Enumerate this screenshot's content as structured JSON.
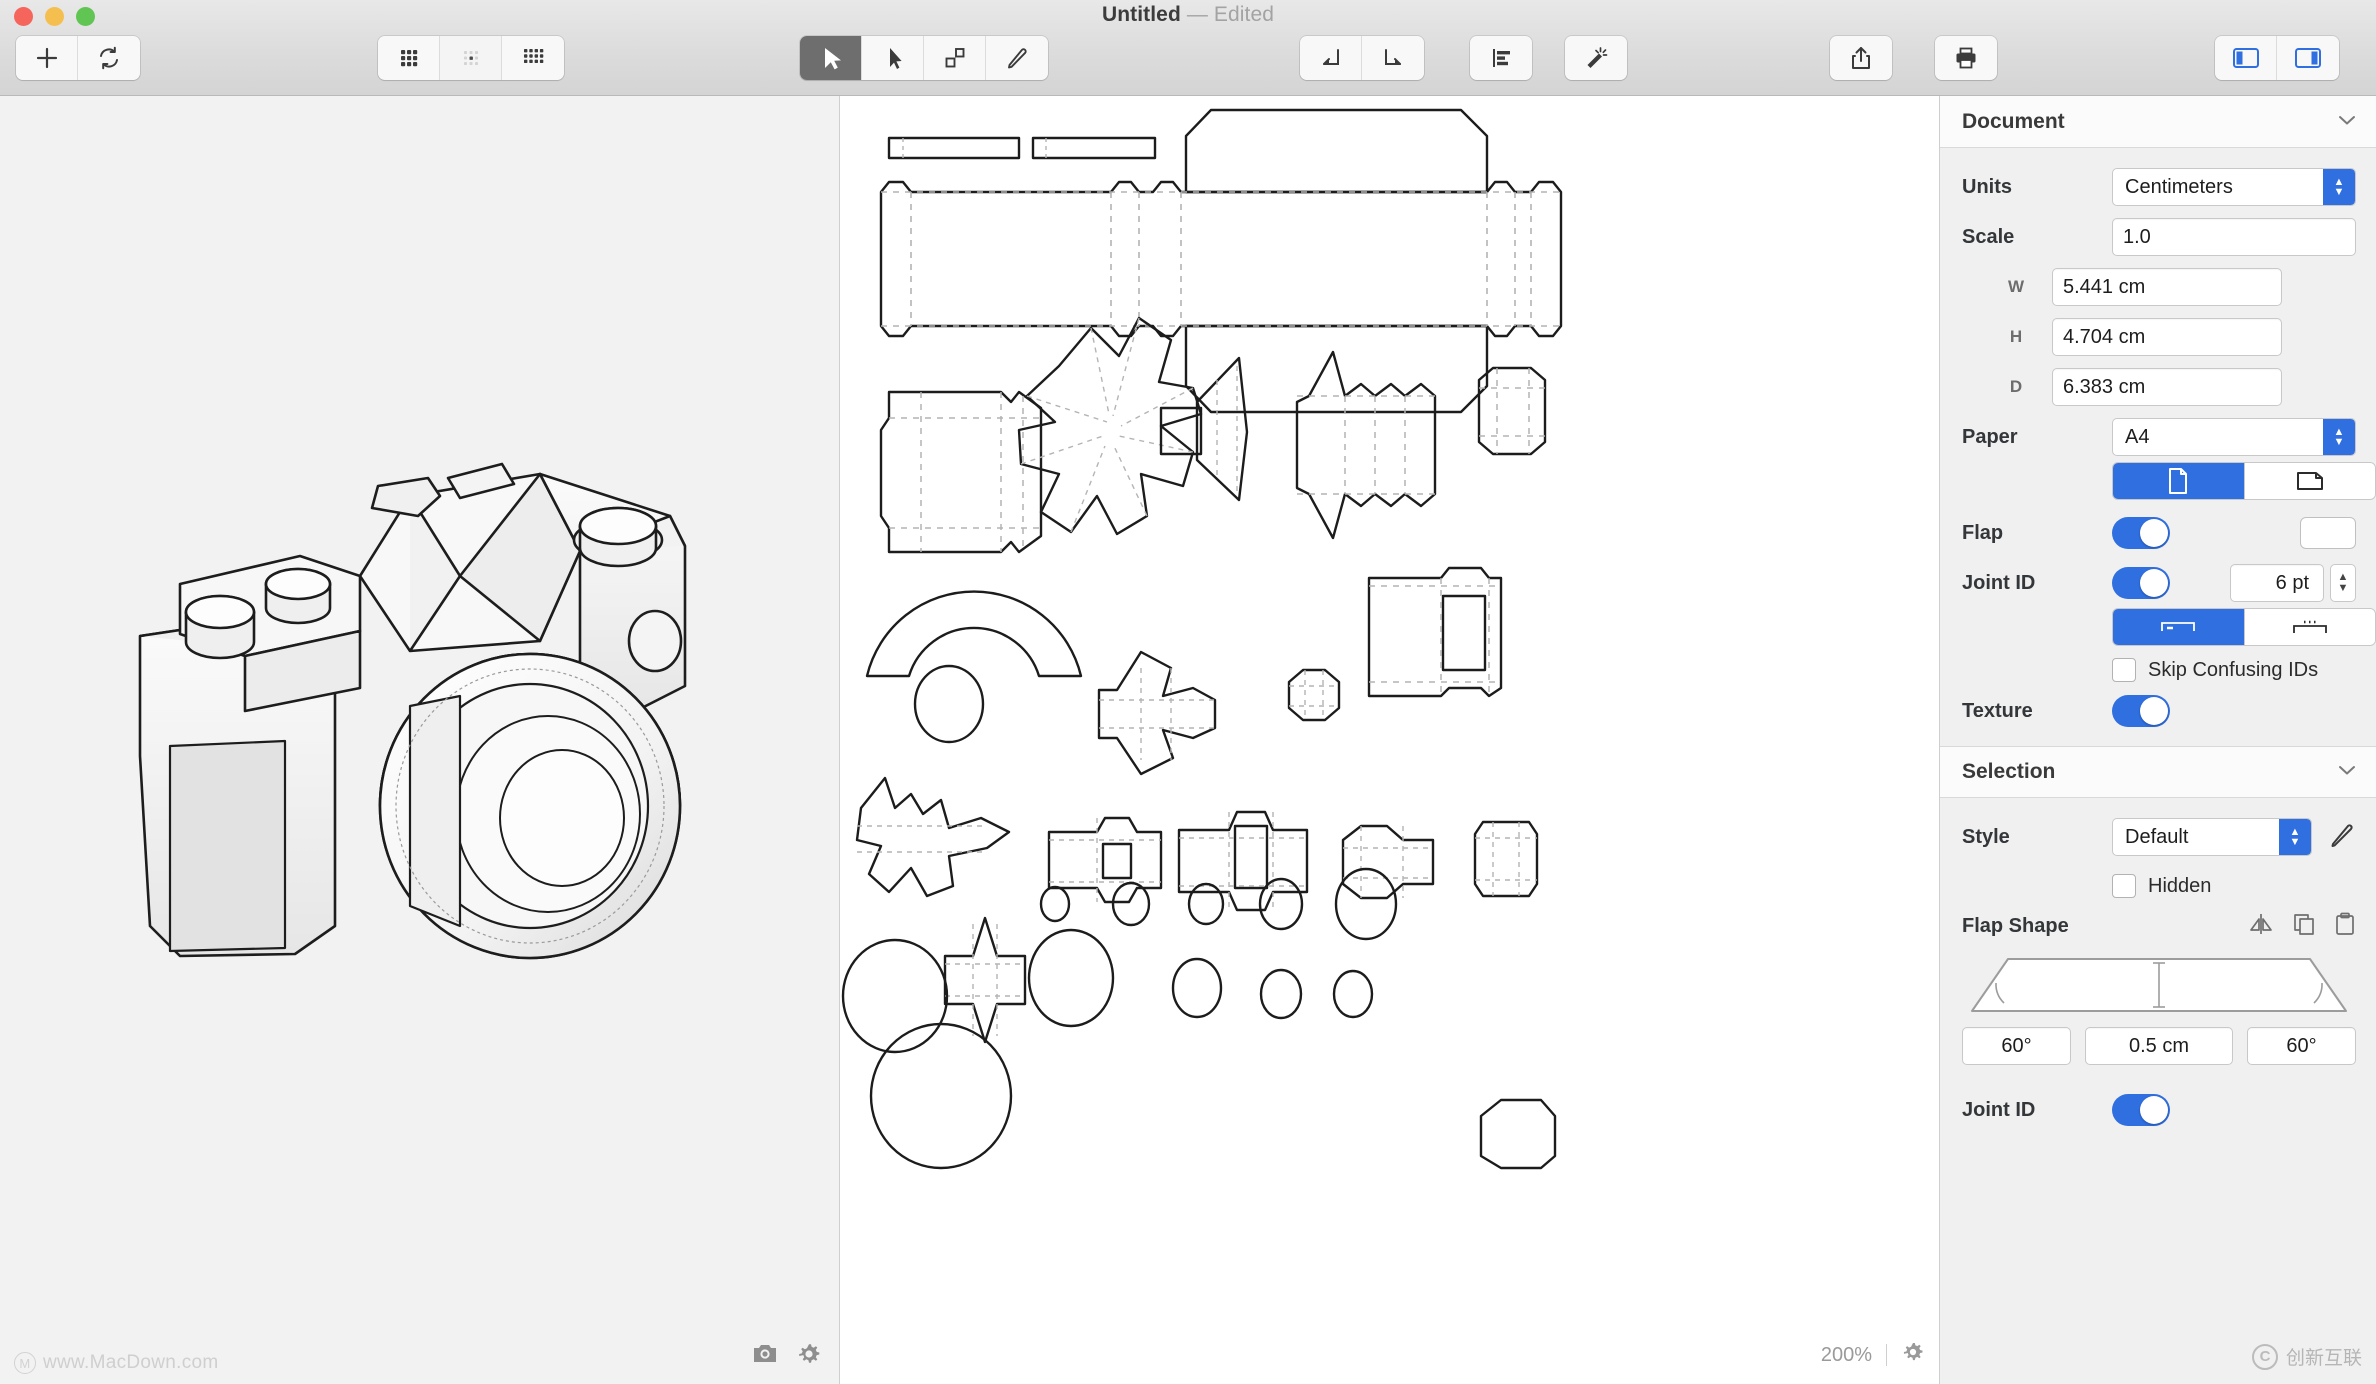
{
  "window": {
    "title": "Untitled",
    "title_separator": "—",
    "state": "Edited"
  },
  "toolbar": {
    "add_label": "+",
    "refresh_icon": "refresh-icon",
    "grid_coarse_icon": "grid-coarse-icon",
    "grid_fine_icon": "grid-fine-icon",
    "grid_dense_icon": "grid-dense-icon",
    "select_icon": "arrow-select-icon",
    "direct_select_icon": "arrow-direct-select-icon",
    "shape_icon": "shapes-icon",
    "erase_icon": "eraser-icon",
    "fold_left_icon": "fold-left-icon",
    "fold_right_icon": "fold-right-icon",
    "align_icon": "align-left-icon",
    "magic_icon": "magic-wand-icon",
    "share_icon": "share-icon",
    "print_icon": "print-icon",
    "left_pane_icon": "toggle-left-pane-icon",
    "right_pane_icon": "toggle-right-pane-icon"
  },
  "left_pane": {
    "model_name": "camera-3d-model",
    "watermark": "www.MacDown.com",
    "camera_icon": "camera-icon",
    "settings_icon": "gear-icon"
  },
  "canvas": {
    "zoom_level": "200%",
    "settings_icon": "gear-icon",
    "content_name": "papercraft-unfold-sheet"
  },
  "inspector": {
    "document": {
      "title": "Document",
      "units_label": "Units",
      "units_value": "Centimeters",
      "scale_label": "Scale",
      "scale_value": "1.0",
      "w_label": "W",
      "w_value": "5.441 cm",
      "h_label": "H",
      "h_value": "4.704 cm",
      "d_label": "D",
      "d_value": "6.383 cm",
      "paper_label": "Paper",
      "paper_value": "A4",
      "orientation_portrait_icon": "page-portrait-icon",
      "orientation_landscape_icon": "page-landscape-icon",
      "flap_label": "Flap",
      "flap_enabled": true,
      "flap_color": "#ffffff",
      "joint_id_label": "Joint ID",
      "joint_id_enabled": true,
      "joint_id_value": "6 pt",
      "joint_style_inside_icon": "joint-inside-icon",
      "joint_style_outside_icon": "joint-outside-icon",
      "skip_confusing_label": "Skip Confusing IDs",
      "skip_confusing_checked": false,
      "texture_label": "Texture",
      "texture_enabled": true
    },
    "selection": {
      "title": "Selection",
      "style_label": "Style",
      "style_value": "Default",
      "edit_style_icon": "pencil-icon",
      "hidden_label": "Hidden",
      "hidden_checked": false,
      "flap_shape_label": "Flap Shape",
      "mirror_icon": "mirror-icon",
      "copy_icon": "copy-icon",
      "paste_icon": "paste-icon",
      "angle_left": "60°",
      "depth": "0.5 cm",
      "angle_right": "60°",
      "joint_id_label": "Joint ID",
      "joint_id_enabled": true
    },
    "watermark": {
      "mark": "C",
      "text": "创新互联"
    }
  },
  "colors": {
    "accent": "#2f6fe0",
    "toolbar_bg": "#dcdcdc",
    "inspector_bg": "#f0f0f0",
    "canvas_bg": "#ffffff",
    "left_pane_bg": "#f2f2f2"
  }
}
